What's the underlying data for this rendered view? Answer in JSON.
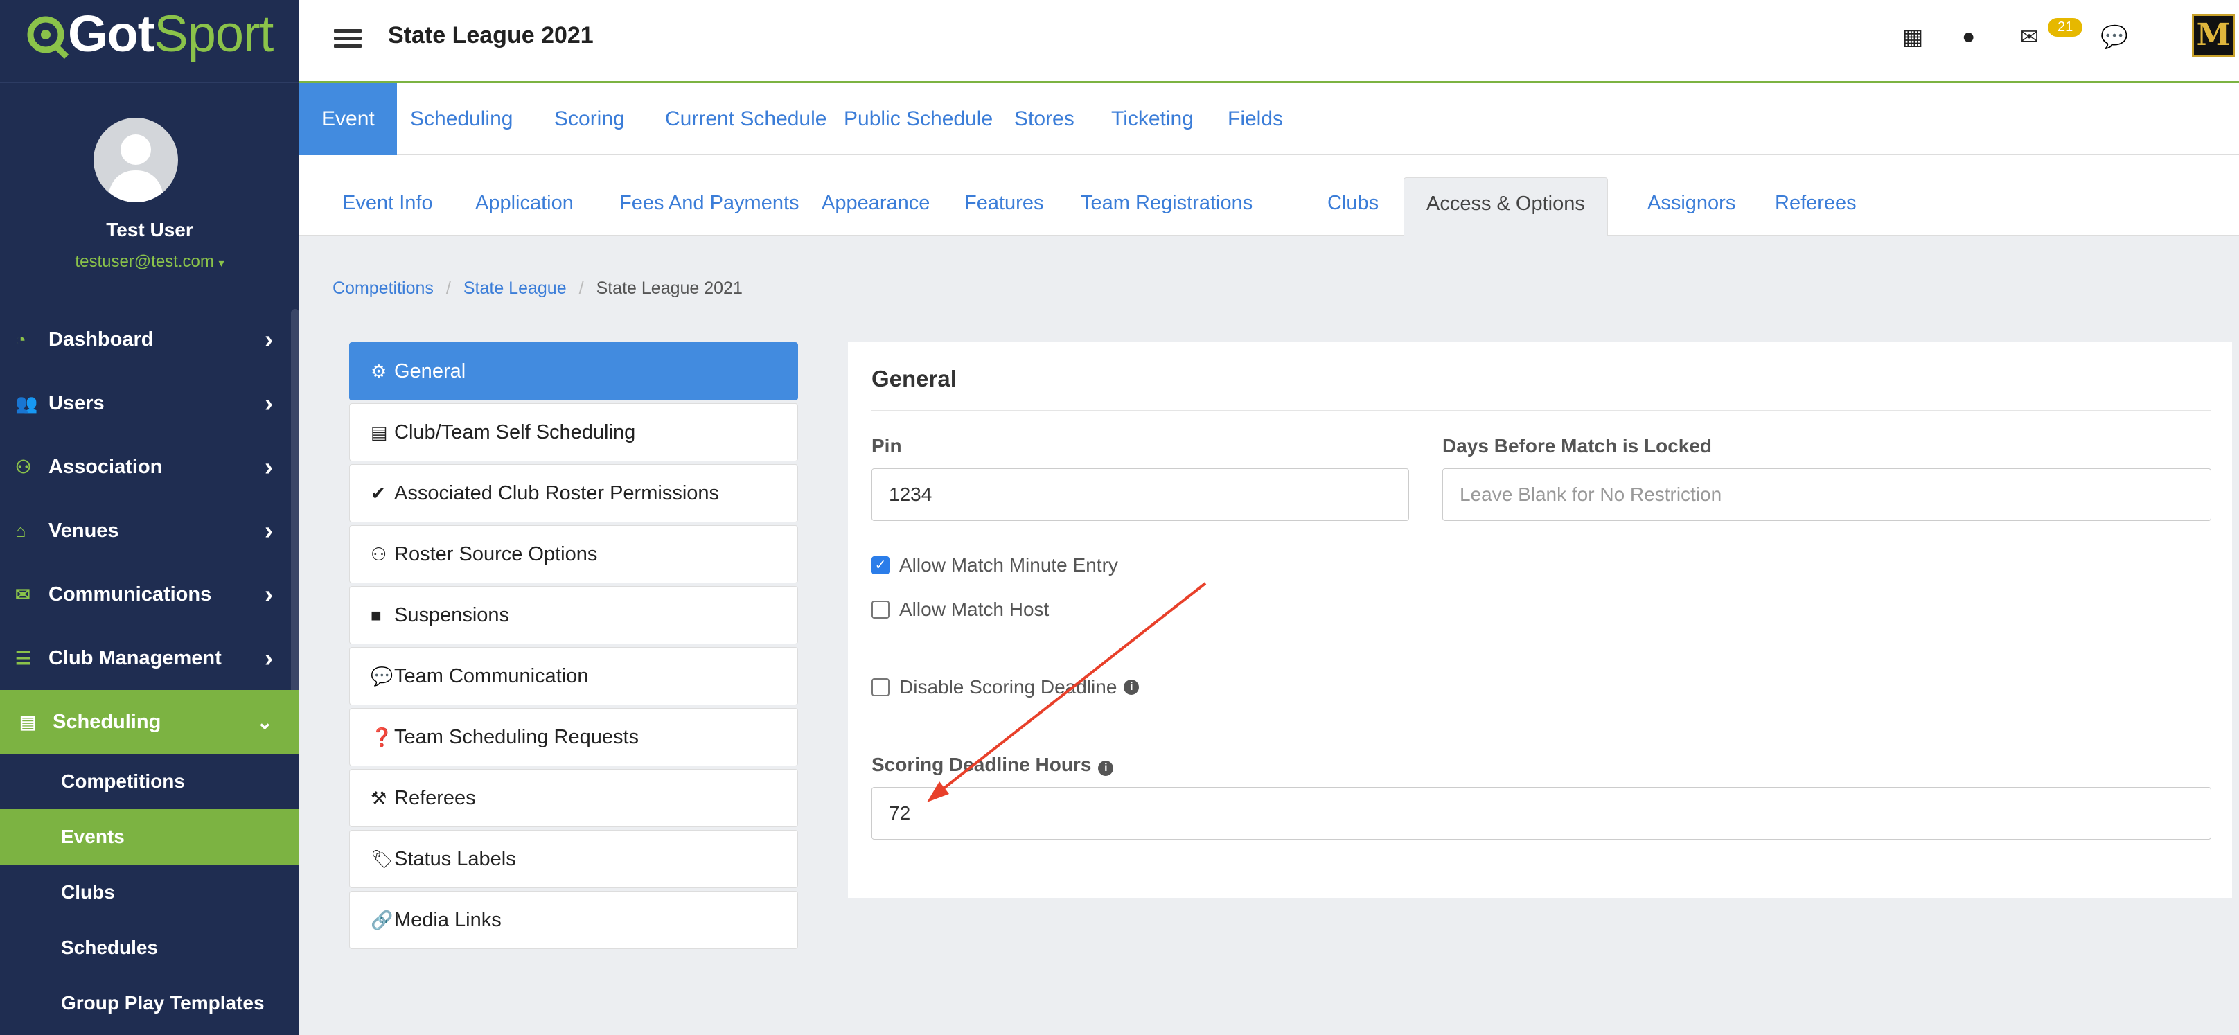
{
  "brand": {
    "logo_text_a": "Got",
    "logo_text_b": "Sport"
  },
  "user": {
    "name": "Test User",
    "email": "testuser@test.com"
  },
  "sidebar": {
    "items": [
      {
        "label": "Dashboard"
      },
      {
        "label": "Users"
      },
      {
        "label": "Association"
      },
      {
        "label": "Venues"
      },
      {
        "label": "Communications"
      },
      {
        "label": "Club Management"
      },
      {
        "label": "Scheduling"
      }
    ],
    "sub": [
      {
        "label": "Competitions"
      },
      {
        "label": "Events"
      },
      {
        "label": "Clubs"
      },
      {
        "label": "Schedules"
      },
      {
        "label": "Group Play Templates"
      }
    ]
  },
  "header": {
    "title": "State League 2021",
    "mail_count": "21",
    "brand_badge": "M"
  },
  "tabs_primary": [
    "Event",
    "Scheduling",
    "Scoring",
    "Current Schedule",
    "Public Schedule",
    "Stores",
    "Ticketing",
    "Fields"
  ],
  "tabs_secondary": [
    "Event Info",
    "Application",
    "Fees And Payments",
    "Appearance",
    "Features",
    "Team Registrations",
    "Clubs",
    "Access & Options",
    "Assignors",
    "Referees"
  ],
  "breadcrumb": {
    "c1": "Competitions",
    "c2": "State League",
    "c3": "State League 2021"
  },
  "menu": [
    "General",
    "Club/Team Self Scheduling",
    "Associated Club Roster Permissions",
    "Roster Source Options",
    "Suspensions",
    "Team Communication",
    "Team Scheduling Requests",
    "Referees",
    "Status Labels",
    "Media Links"
  ],
  "panel": {
    "title": "General",
    "pin_label": "Pin",
    "pin_value": "1234",
    "days_label": "Days Before Match is Locked",
    "days_placeholder": "Leave Blank for No Restriction",
    "allow_minute": "Allow Match Minute Entry",
    "allow_minute_checked": true,
    "allow_host": "Allow Match Host",
    "allow_host_checked": false,
    "disable_deadline": "Disable Scoring Deadline",
    "disable_deadline_checked": false,
    "deadline_label": "Scoring Deadline Hours",
    "deadline_value": "72"
  },
  "colors": {
    "sidebar": "#1f2d51",
    "accent_green": "#7cb342",
    "accent_blue": "#428bdf",
    "annotation": "#e8402a"
  }
}
